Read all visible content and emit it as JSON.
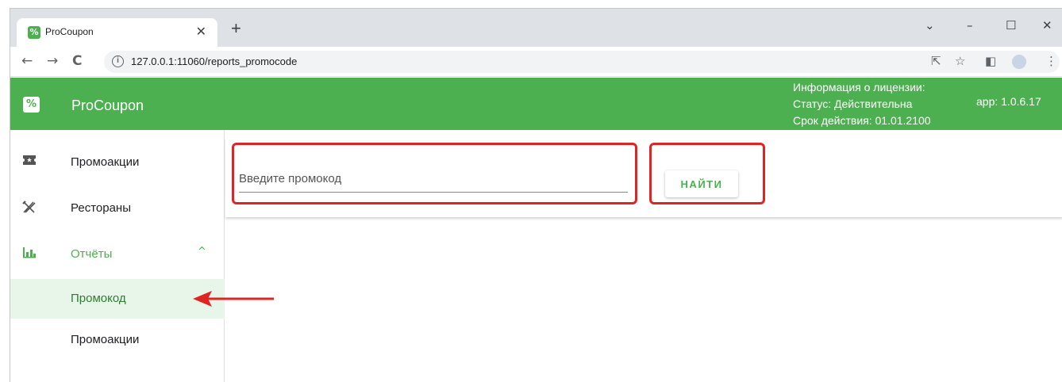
{
  "browser": {
    "tab_title": "ProCoupon",
    "tab_favicon": "%",
    "tab_close": "✕",
    "new_tab": "+",
    "url": "127.0.0.1:11060/reports_promocode",
    "controls": {
      "dropdown": "⌄",
      "minimize": "–",
      "maximize": "☐",
      "close": "✕"
    }
  },
  "header": {
    "logo_glyph": "%",
    "app_name": "ProCoupon",
    "license_title": "Информация о лицензии:",
    "license_status": "Статус: Действительна",
    "license_expiry": "Срок действия: 01.01.2100",
    "app_version": "app: 1.0.6.17"
  },
  "sidebar": {
    "items": [
      {
        "label": "Промоакции",
        "icon": "ticket-icon"
      },
      {
        "label": "Рестораны",
        "icon": "cutlery-icon"
      },
      {
        "label": "Отчёты",
        "icon": "bar-chart-icon",
        "expanded": true
      },
      {
        "label": "Промокод",
        "active": true
      },
      {
        "label": "Промоакции"
      }
    ]
  },
  "main": {
    "search_placeholder": "Введите промокод",
    "search_value": "",
    "find_label": "НАЙТИ"
  },
  "colors": {
    "brand": "#4caf50",
    "active_bg": "#e8f5e9",
    "annotation": "#e02424"
  }
}
